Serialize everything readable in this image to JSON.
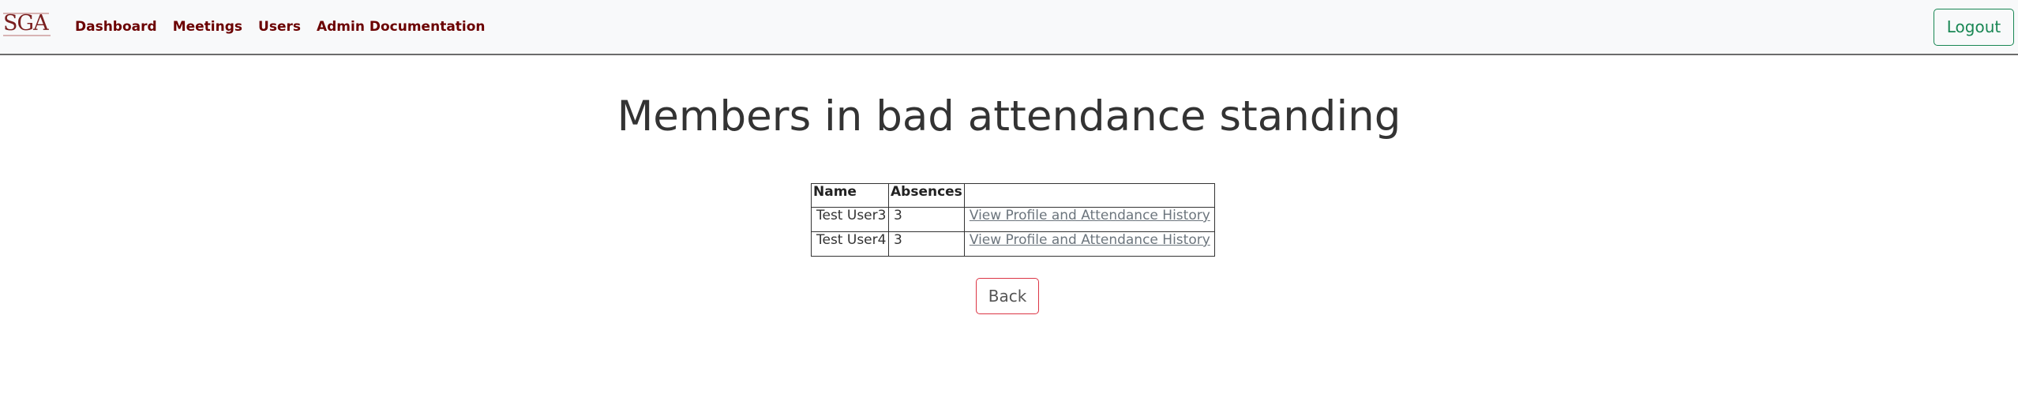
{
  "navbar": {
    "logo_text": "SGA",
    "links": [
      {
        "label": "Dashboard"
      },
      {
        "label": "Meetings"
      },
      {
        "label": "Users"
      },
      {
        "label": "Admin Documentation"
      }
    ],
    "logout_label": "Logout"
  },
  "main": {
    "title": "Members in bad attendance standing",
    "table": {
      "headers": [
        "Name",
        "Absences",
        ""
      ],
      "rows": [
        {
          "name": "Test User3",
          "absences": "3",
          "link": "View Profile and Attendance History"
        },
        {
          "name": "Test User4",
          "absences": "3",
          "link": "View Profile and Attendance History"
        }
      ]
    },
    "back_label": "Back"
  },
  "colors": {
    "nav_link": "#6b0000",
    "logout": "#198754",
    "back_border": "#dc3545",
    "link": "#6c757d"
  }
}
